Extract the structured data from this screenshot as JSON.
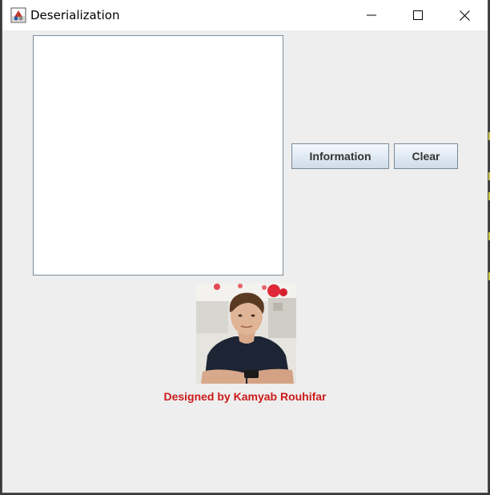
{
  "window": {
    "title": "Deserialization",
    "icon": "java-app-icon",
    "controls": [
      "minimize-icon",
      "maximize-icon",
      "close-icon"
    ]
  },
  "text_area": {
    "value": ""
  },
  "buttons": {
    "information_label": "Information",
    "clear_label": "Clear"
  },
  "photo": {
    "description_icon": "profile-photo"
  },
  "credit": {
    "text": "Designed by Kamyab Rouhifar",
    "color": "#cc1a1a"
  },
  "colors": {
    "background": "#eeeeee",
    "button_gradient_top": "#f4f8fc",
    "button_gradient_bottom": "#cfdceb"
  }
}
